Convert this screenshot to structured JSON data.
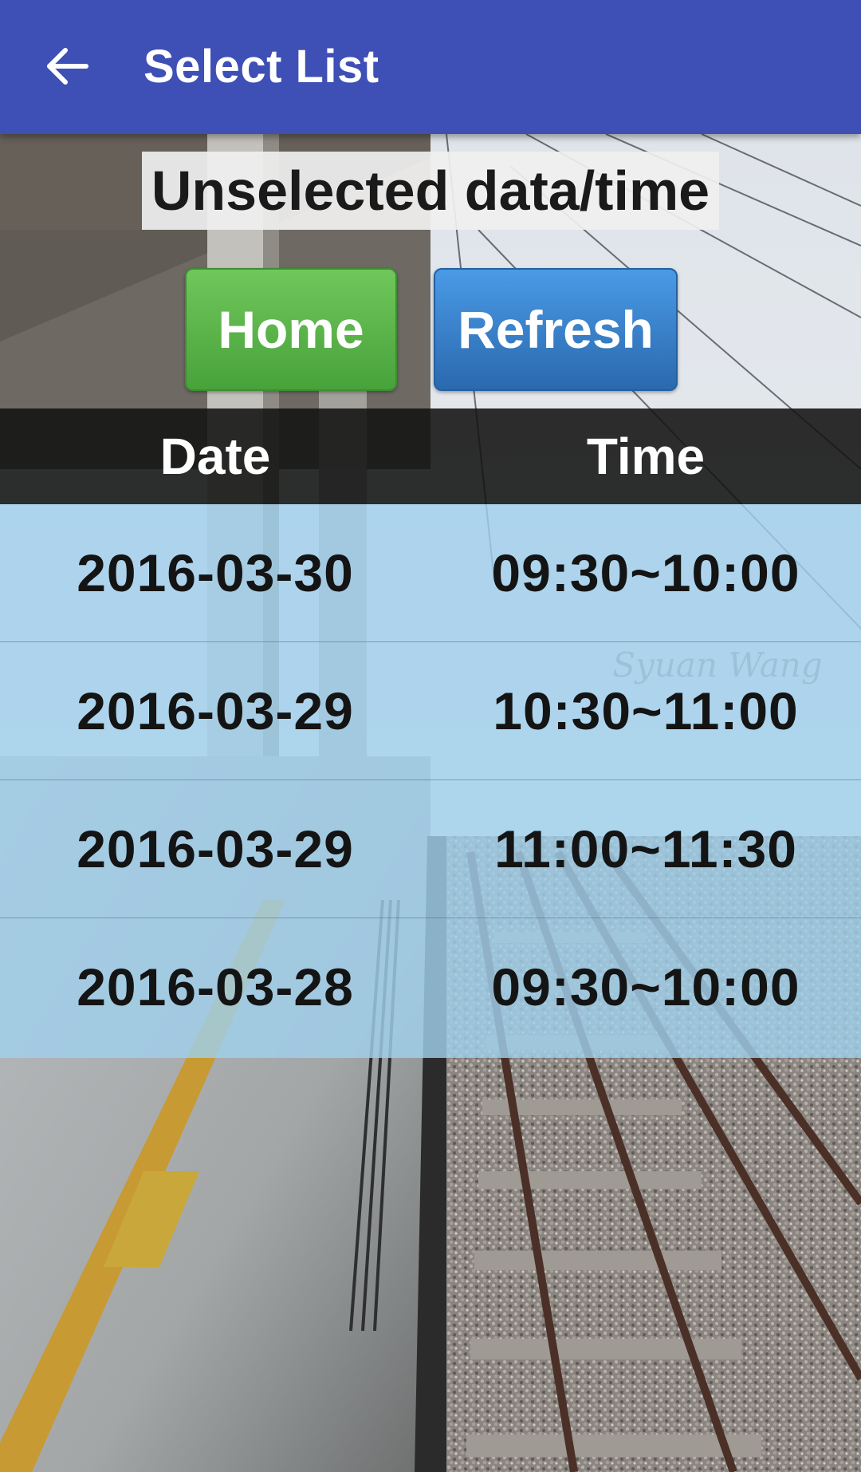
{
  "appbar": {
    "title": "Select List",
    "back_icon": "arrow-left-icon",
    "color": "#3e4fb5"
  },
  "status": {
    "text": "Unselected data/time"
  },
  "buttons": {
    "home_label": "Home",
    "refresh_label": "Refresh",
    "home_color": "#5cb84a",
    "refresh_color": "#3a82cb"
  },
  "table": {
    "headers": [
      "Date",
      "Time"
    ],
    "rows": [
      {
        "date": "2016-03-30",
        "time": "09:30~10:00"
      },
      {
        "date": "2016-03-29",
        "time": "10:30~11:00"
      },
      {
        "date": "2016-03-29",
        "time": "11:00~11:30"
      },
      {
        "date": "2016-03-28",
        "time": "09:30~10:00"
      }
    ]
  },
  "watermark": {
    "text": "Syuan Wang"
  }
}
